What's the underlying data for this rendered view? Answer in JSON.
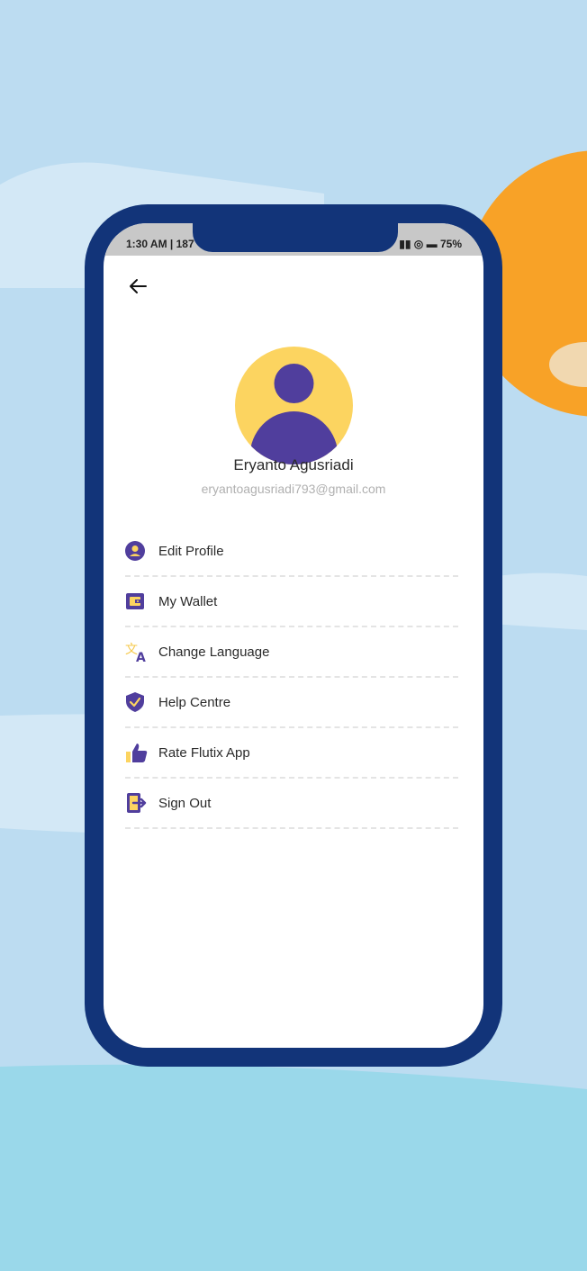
{
  "status_bar": {
    "left_text": "1:30 AM | 187",
    "right_text": "75%"
  },
  "profile": {
    "name": "Eryanto Agusriadi",
    "email": "eryantoagusriadi793@gmail.com"
  },
  "menu": {
    "items": [
      {
        "label": "Edit Profile",
        "icon": "user-circle-icon"
      },
      {
        "label": "My Wallet",
        "icon": "wallet-icon"
      },
      {
        "label": "Change Language",
        "icon": "translate-icon"
      },
      {
        "label": "Help Centre",
        "icon": "shield-check-icon"
      },
      {
        "label": "Rate Flutix App",
        "icon": "thumbs-up-icon"
      },
      {
        "label": "Sign Out",
        "icon": "sign-out-icon"
      }
    ]
  },
  "colors": {
    "primary_purple": "#503e9d",
    "accent_yellow": "#fcd460",
    "phone_frame": "#123479",
    "background": "#bcdcf1"
  }
}
